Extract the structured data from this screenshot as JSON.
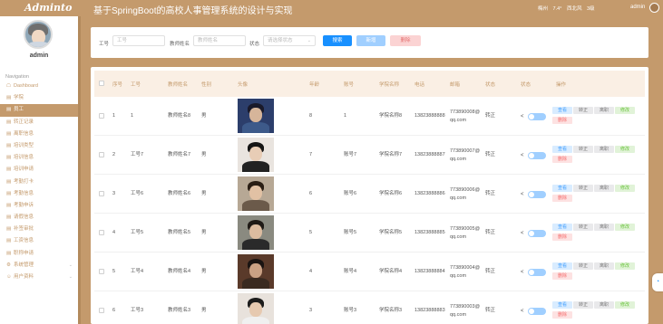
{
  "header": {
    "logo": "Adminto",
    "title": "基于SpringBoot的高校人事管理系统的设计与实现",
    "weather": [
      "梅州",
      "7.4°",
      "西北风",
      "3级"
    ],
    "user": "admin"
  },
  "sidebar": {
    "username": "admin",
    "caption": "Navigation",
    "items": [
      {
        "icon": "☖",
        "label": "Dashboard"
      },
      {
        "icon": "▤",
        "label": "学院"
      },
      {
        "icon": "▤",
        "label": "员工"
      },
      {
        "icon": "▤",
        "label": "转正记录"
      },
      {
        "icon": "▤",
        "label": "离职信息"
      },
      {
        "icon": "▤",
        "label": "培训类型"
      },
      {
        "icon": "▤",
        "label": "培训信息"
      },
      {
        "icon": "▤",
        "label": "培训申请"
      },
      {
        "icon": "▤",
        "label": "考勤打卡"
      },
      {
        "icon": "▤",
        "label": "考勤信息"
      },
      {
        "icon": "▤",
        "label": "考勤申诉"
      },
      {
        "icon": "▤",
        "label": "请假信息"
      },
      {
        "icon": "▤",
        "label": "补签审批"
      },
      {
        "icon": "▤",
        "label": "工资信息"
      },
      {
        "icon": "▤",
        "label": "职称申请"
      },
      {
        "icon": "⚙",
        "label": "系统管理"
      },
      {
        "icon": "☺",
        "label": "用户资料"
      }
    ],
    "active_index": 2
  },
  "filters": {
    "f1_label": "工号",
    "f1_placeholder": "工号",
    "f2_label": "教师姓名",
    "f2_placeholder": "教师姓名",
    "f3_label": "状态",
    "f3_placeholder": "请选择状态",
    "search": "搜索",
    "add": "新增",
    "delete": "删除"
  },
  "table": {
    "headers": {
      "index": "序号",
      "no": "工号",
      "name": "教师姓名",
      "gender": "性别",
      "avatar": "头像",
      "age": "年龄",
      "acct": "账号",
      "college": "学院名称",
      "phone": "电话",
      "email": "邮箱",
      "status1": "状态",
      "status2": "状态",
      "ops": "操作"
    },
    "ops": {
      "view": "查看",
      "convert": "转正",
      "resign": "离职",
      "edit": "修改",
      "delete": "删除"
    },
    "rows": [
      {
        "index": "1",
        "no": "1",
        "name": "教师姓名8",
        "gender": "男",
        "age": "8",
        "acct": "1",
        "college": "学院名称8",
        "phone": "13823888888",
        "email": "773890008@qq.com",
        "status": "转正"
      },
      {
        "index": "2",
        "no": "工号7",
        "name": "教师姓名7",
        "gender": "男",
        "age": "7",
        "acct": "账号7",
        "college": "学院名称7",
        "phone": "13823888887",
        "email": "773890007@qq.com",
        "status": "转正"
      },
      {
        "index": "3",
        "no": "工号6",
        "name": "教师姓名6",
        "gender": "男",
        "age": "6",
        "acct": "账号6",
        "college": "学院名称6",
        "phone": "13823888886",
        "email": "773890006@qq.com",
        "status": "转正"
      },
      {
        "index": "4",
        "no": "工号5",
        "name": "教师姓名5",
        "gender": "男",
        "age": "5",
        "acct": "账号5",
        "college": "学院名称5",
        "phone": "13823888885",
        "email": "773890005@qq.com",
        "status": "转正"
      },
      {
        "index": "5",
        "no": "工号4",
        "name": "教师姓名4",
        "gender": "男",
        "age": "4",
        "acct": "账号4",
        "college": "学院名称4",
        "phone": "13823888884",
        "email": "773890004@qq.com",
        "status": "转正"
      },
      {
        "index": "6",
        "no": "工号3",
        "name": "教师姓名3",
        "gender": "男",
        "age": "3",
        "acct": "账号3",
        "college": "学院名称3",
        "phone": "13823888883",
        "email": "773890003@qq.com",
        "status": "转正"
      }
    ]
  },
  "colors": {
    "accent": "#c49a6c",
    "primary": "#1890ff",
    "header_bg": "#faefe4"
  }
}
